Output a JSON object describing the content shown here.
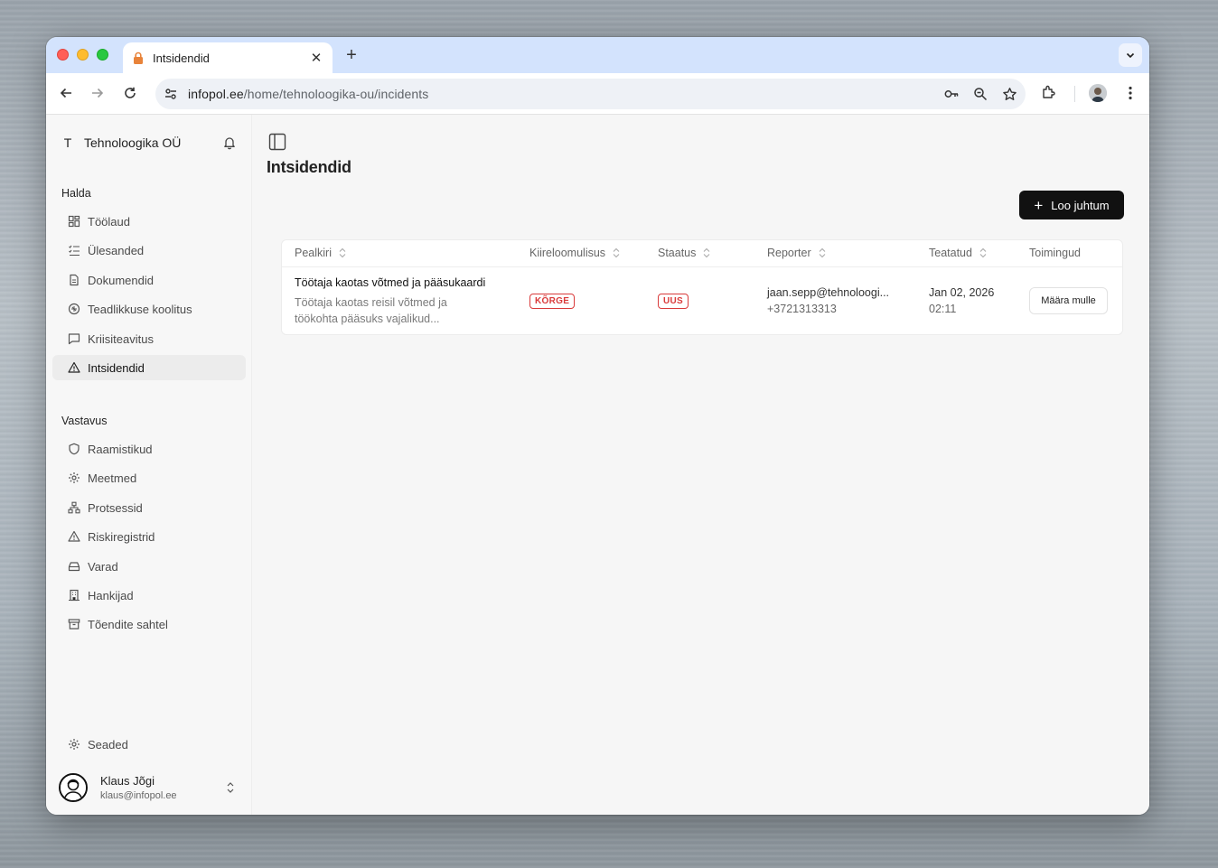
{
  "browser": {
    "tab_title": "Intsidendid",
    "url_domain": "infopol.ee",
    "url_path": "/home/tehnoloogika-ou/incidents"
  },
  "sidebar": {
    "org_letter": "T",
    "org_name": "Tehnoloogika OÜ",
    "section_manage": "Halda",
    "manage_items": [
      {
        "label": "Töölaud",
        "icon": "dashboard-icon"
      },
      {
        "label": "Ülesanded",
        "icon": "tasks-icon"
      },
      {
        "label": "Dokumendid",
        "icon": "document-icon"
      },
      {
        "label": "Teadlikkuse koolitus",
        "icon": "training-icon"
      },
      {
        "label": "Kriisiteavitus",
        "icon": "message-icon"
      },
      {
        "label": "Intsidendid",
        "icon": "warning-icon"
      }
    ],
    "section_compliance": "Vastavus",
    "compliance_items": [
      {
        "label": "Raamistikud",
        "icon": "shield-icon"
      },
      {
        "label": "Meetmed",
        "icon": "gear-icon"
      },
      {
        "label": "Protsessid",
        "icon": "workflow-icon"
      },
      {
        "label": "Riskiregistrid",
        "icon": "warning-icon"
      },
      {
        "label": "Varad",
        "icon": "storage-icon"
      },
      {
        "label": "Hankijad",
        "icon": "building-icon"
      },
      {
        "label": "Tõendite sahtel",
        "icon": "archive-icon"
      }
    ],
    "settings_label": "Seaded",
    "user_name": "Klaus Jõgi",
    "user_email": "klaus@infopol.ee"
  },
  "main": {
    "title": "Intsidendid",
    "create_button": "Loo juhtum",
    "columns": [
      "Pealkiri",
      "Kiireloomulisus",
      "Staatus",
      "Reporter",
      "Teatatud",
      "Toimingud"
    ],
    "rows": [
      {
        "title": "Töötaja kaotas võtmed ja pääsukaardi",
        "description": "Töötaja kaotas reisil võtmed ja töökohta pääsuks vajalikud...",
        "urgency": "KÕRGE",
        "status": "UUS",
        "reporter_email": "jaan.sepp@tehnoloogi...",
        "reporter_phone": "+3721313313",
        "date": "Jan 02, 2026",
        "time": "02:11",
        "action": "Määra mulle"
      }
    ]
  },
  "colors": {
    "accent": "#111111",
    "badge_red": "#d93a3a",
    "tabstrip": "#d3e3fd"
  }
}
